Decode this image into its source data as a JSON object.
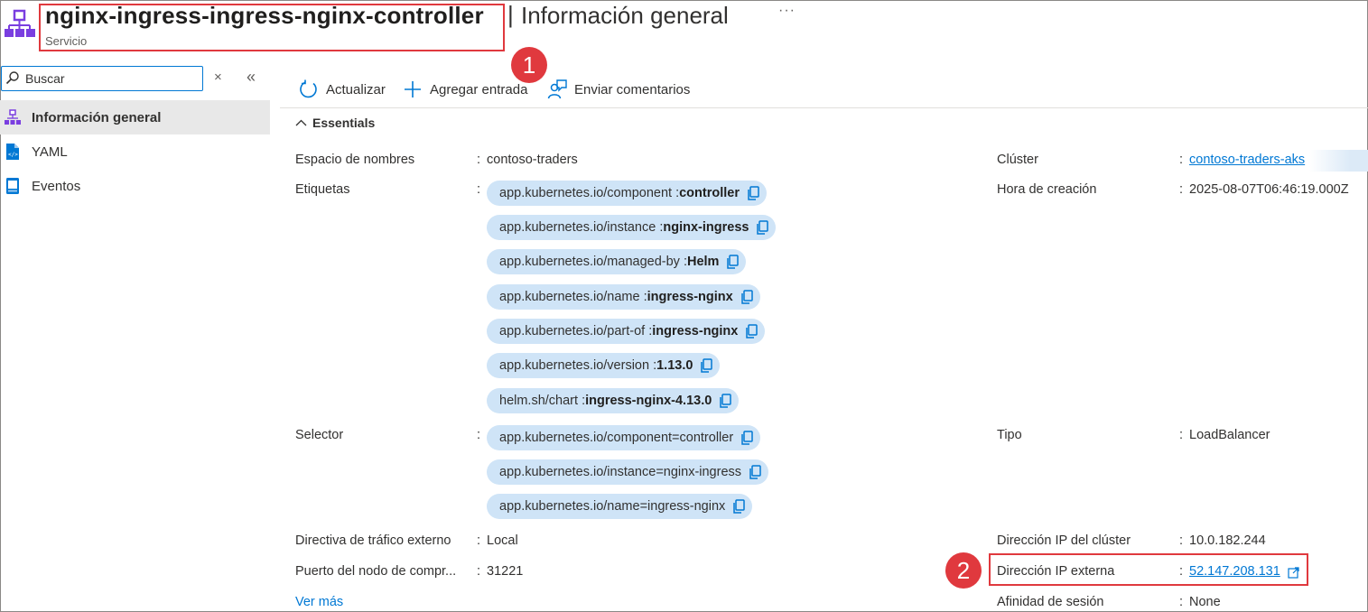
{
  "header": {
    "title": "nginx-ingress-ingress-nginx-controller",
    "separator": "|",
    "subtitle": "Información general",
    "resource_type": "Servicio",
    "more": "···"
  },
  "callouts": {
    "one": "1",
    "two": "2"
  },
  "sidebar": {
    "search_placeholder": "Buscar",
    "clear": "×",
    "collapse": "«",
    "items": [
      {
        "label": "Información general",
        "icon": "service-icon",
        "active": true
      },
      {
        "label": "YAML",
        "icon": "yaml-file-icon"
      },
      {
        "label": "Eventos",
        "icon": "events-icon"
      }
    ]
  },
  "toolbar": {
    "refresh": "Actualizar",
    "add_entry": "Agregar entrada",
    "feedback": "Enviar comentarios"
  },
  "essentials": {
    "label": "Essentials",
    "left": {
      "namespace": {
        "label": "Espacio de nombres",
        "value": "contoso-traders"
      },
      "labels": {
        "label": "Etiquetas",
        "tags": [
          {
            "key": "app.kubernetes.io/component : ",
            "value": "controller"
          },
          {
            "key": "app.kubernetes.io/instance : ",
            "value": "nginx-ingress"
          },
          {
            "key": "app.kubernetes.io/managed-by : ",
            "value": "Helm"
          },
          {
            "key": "app.kubernetes.io/name : ",
            "value": "ingress-nginx"
          },
          {
            "key": "app.kubernetes.io/part-of : ",
            "value": "ingress-nginx"
          },
          {
            "key": "app.kubernetes.io/version : ",
            "value": "1.13.0"
          },
          {
            "key": "helm.sh/chart : ",
            "value": "ingress-nginx-4.13.0"
          }
        ]
      },
      "selector": {
        "label": "Selector",
        "tags": [
          "app.kubernetes.io/component=controller",
          "app.kubernetes.io/instance=nginx-ingress",
          "app.kubernetes.io/name=ingress-nginx"
        ]
      },
      "traffic_policy": {
        "label": "Directiva de tráfico externo",
        "value": "Local"
      },
      "node_port": {
        "label": "Puerto del nodo de compr...",
        "value": "31221"
      },
      "see_more": "Ver más"
    },
    "right": {
      "cluster": {
        "label": "Clúster",
        "value": "contoso-traders-aks"
      },
      "created": {
        "label": "Hora de creación",
        "value": "2025-08-07T06:46:19.000Z"
      },
      "type": {
        "label": "Tipo",
        "value": "LoadBalancer"
      },
      "cluster_ip": {
        "label": "Dirección IP del clúster",
        "value": "10.0.182.244"
      },
      "external_ip": {
        "label": "Dirección IP externa",
        "value": "52.147.208.131"
      },
      "session_affinity": {
        "label": "Afinidad de sesión",
        "value": "None"
      }
    }
  },
  "colors": {
    "accent": "#0078d4",
    "tag_bg": "#cfe4f7",
    "callout": "#e0393e",
    "icon_purple": "#7a3ee0"
  }
}
